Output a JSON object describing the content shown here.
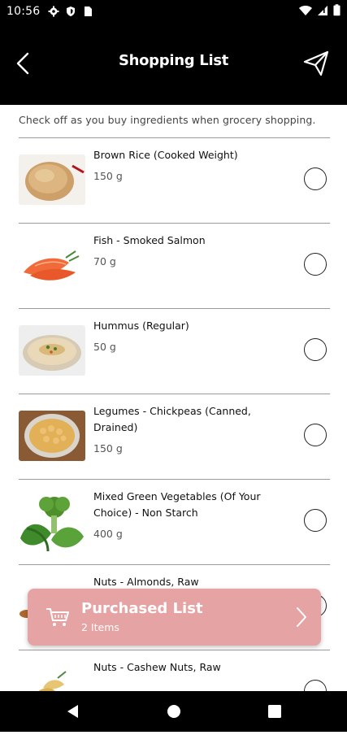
{
  "status": {
    "time": "10:56",
    "icons": [
      "gear-icon",
      "shield-icon",
      "sim-card-icon",
      "wifi-icon",
      "signal-icon",
      "battery-icon"
    ]
  },
  "appbar": {
    "title": "Shopping List",
    "back_icon": "chevron-left-icon",
    "send_icon": "paper-plane-icon"
  },
  "subtitle": "Check off as you buy ingredients when grocery shopping.",
  "items": [
    {
      "name": "Brown Rice (Cooked Weight)",
      "qty": "150 g",
      "checked": false
    },
    {
      "name": "Fish - Smoked Salmon",
      "qty": "70 g",
      "checked": false
    },
    {
      "name": "Hummus (Regular)",
      "qty": "50 g",
      "checked": false
    },
    {
      "name": "Legumes - Chickpeas (Canned, Drained)",
      "qty": "150 g",
      "checked": false
    },
    {
      "name": "Mixed Green Vegetables (Of Your Choice) - Non Starch",
      "qty": "400 g",
      "checked": false
    },
    {
      "name": "Nuts - Almonds, Raw",
      "qty": "",
      "checked": false
    },
    {
      "name": "Nuts - Cashew Nuts, Raw",
      "qty": "",
      "checked": false
    }
  ],
  "purchased": {
    "label": "Purchased List",
    "count": "2 Items",
    "color": "#e6a3a4"
  },
  "colors": {
    "bars": "#000000",
    "accent": "#e6a3a4"
  }
}
